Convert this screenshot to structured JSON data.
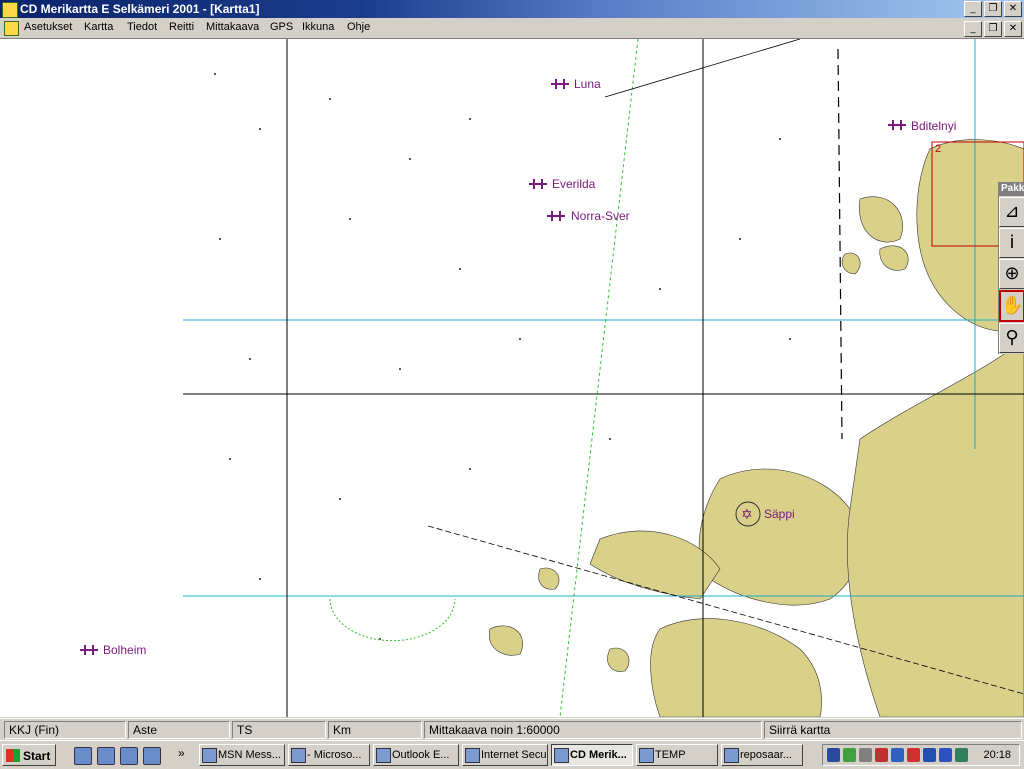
{
  "window": {
    "title": "CD Merikartta  E Selkämeri 2001 - [Kartta1]",
    "minimize": "_",
    "restore": "❐",
    "close": "✕"
  },
  "menu": [
    "Asetukset",
    "Kartta",
    "Tiedot",
    "Reitti",
    "Mittakaava",
    "GPS",
    "Ikkuna",
    "Ohje"
  ],
  "map": {
    "labels": [
      {
        "text": "Luna"
      },
      {
        "text": "Bditelnyi"
      },
      {
        "text": "Everilda"
      },
      {
        "text": "Norra-Sver"
      },
      {
        "text": "Säppi"
      },
      {
        "text": "Bolheim"
      }
    ],
    "inset_number": "2",
    "colors": {
      "sea": "#ffffff",
      "land": "#d9d08a",
      "grid": "#1cb0c8",
      "route": "#30c030",
      "label": "#7a1a7a"
    }
  },
  "tool_palette": {
    "title": "Pakki",
    "tools": [
      "measure-icon",
      "info-icon",
      "zoom-in-icon",
      "pan-hand-icon",
      "pin-add-icon"
    ],
    "glyphs": [
      "⊿",
      "i",
      "⊕",
      "✋",
      "⚲"
    ],
    "active_index": 3
  },
  "statusbar": [
    "KKJ (Fin)",
    "Aste",
    "TS",
    "Km",
    "Mittakaava noin 1:60000",
    "Siirrä kartta"
  ],
  "taskbar": {
    "start": "Start",
    "chevron": "»",
    "tasks": [
      {
        "label": "MSN Mess...",
        "active": false
      },
      {
        "label": "- Microso...",
        "active": false
      },
      {
        "label": "Outlook E...",
        "active": false
      },
      {
        "label": "Internet Secu...",
        "active": false
      },
      {
        "label": "CD Merik...",
        "active": true
      },
      {
        "label": "TEMP",
        "active": false
      },
      {
        "label": "reposaar...",
        "active": false
      }
    ],
    "clock": "20:18"
  }
}
